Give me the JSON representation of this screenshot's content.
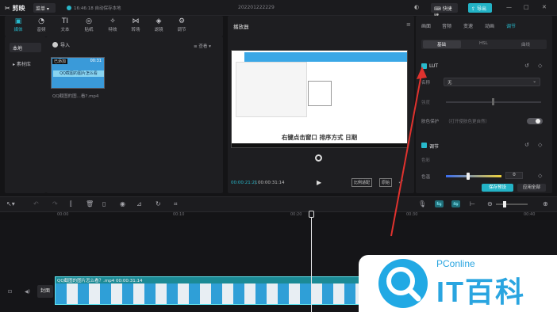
{
  "topbar": {
    "app_name": "剪映",
    "menu_label": "菜单",
    "autosave": "16:46:18 自动保存本地",
    "doc_title": "202201222229",
    "shortcut_label": "快捷键",
    "export_label": "导出",
    "controls": [
      "—",
      "□",
      "✕"
    ]
  },
  "media_toolbar": {
    "tools": [
      {
        "label": "媒体",
        "icon": "▣"
      },
      {
        "label": "音频",
        "icon": "◔"
      },
      {
        "label": "文本",
        "icon": "TI"
      },
      {
        "label": "贴纸",
        "icon": "◎"
      },
      {
        "label": "特效",
        "icon": "✧"
      },
      {
        "label": "转场",
        "icon": "⋈"
      },
      {
        "label": "滤镜",
        "icon": "◈"
      },
      {
        "label": "调节",
        "icon": "⚙"
      }
    ]
  },
  "media_side": {
    "items": [
      "本地",
      "素材库"
    ]
  },
  "media_main": {
    "import_label": "导入",
    "sort_label": "≡ 查看 ▾",
    "clip_added": "已添加",
    "clip_duration": "00:31",
    "clip_caption": "QQ截图的图片怎么看",
    "clip_name": "QQ截图的图...看?.mp4"
  },
  "player": {
    "title": "播放器",
    "subtitle": "右键点击窗口  排序方式  日期",
    "current_time": "00:00:21:21",
    "total_time": "00:00:31:14",
    "ratio_label": "比例适配",
    "original_label": "原始"
  },
  "props": {
    "tabs": [
      "画面",
      "音频",
      "变速",
      "动画",
      "调节"
    ],
    "subtabs": [
      "基础",
      "HSL",
      "曲线"
    ],
    "lut_label": "LUT",
    "name_label": "名称",
    "name_value": "无",
    "strength_label": "强度",
    "color_protect_label": "肤色保护",
    "color_protect_hint": "（打开使肤色更自然）",
    "adjust_label": "调节",
    "color_label": "色彩",
    "temp_label": "色温",
    "temp_value": "0",
    "save_preset_label": "保存预设",
    "apply_all_label": "应用全部"
  },
  "timeline": {
    "ruler": [
      "00:00",
      "00:10",
      "00:20",
      "00:30",
      "00:40"
    ],
    "clip_title": "QQ截图的图片怎么看？.mp4   00:00:31:14",
    "cover_label": "封面"
  },
  "watermark": {
    "brand_top": "PConline",
    "brand_main": "IT百科"
  }
}
